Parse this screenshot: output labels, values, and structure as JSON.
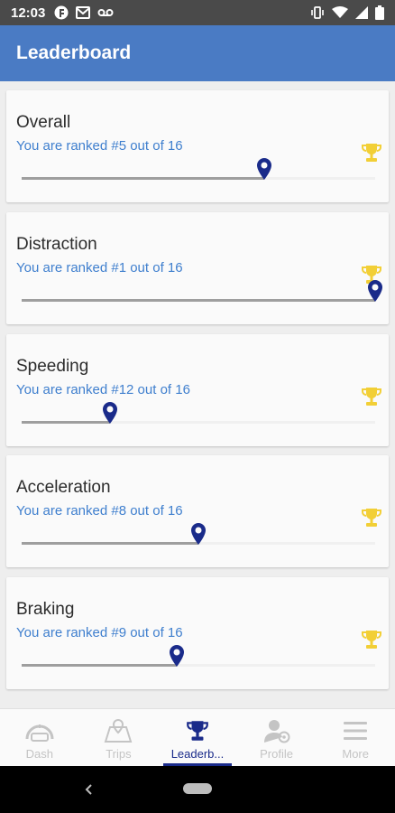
{
  "status_bar": {
    "time": "12:03"
  },
  "app_bar": {
    "title": "Leaderboard"
  },
  "colors": {
    "primary": "#4a7bc4",
    "rank_text": "#3f7fce",
    "trophy": "#f2cf36",
    "pin": "#1a2b8a",
    "active_nav": "#1a2b8a"
  },
  "cards": [
    {
      "title": "Overall",
      "rank_text": "You are ranked #5 out of 16",
      "position": 0.685
    },
    {
      "title": "Distraction",
      "rank_text": "You are ranked #1 out of 16",
      "position": 1.0
    },
    {
      "title": "Speeding",
      "rank_text": "You are ranked #12 out of 16",
      "position": 0.25
    },
    {
      "title": "Acceleration",
      "rank_text": "You are ranked #8 out of 16",
      "position": 0.5
    },
    {
      "title": "Braking",
      "rank_text": "You are ranked #9 out of 16",
      "position": 0.44
    }
  ],
  "bottom_nav": [
    {
      "label": "Dash",
      "icon": "speedometer-icon",
      "active": false
    },
    {
      "label": "Trips",
      "icon": "map-icon",
      "active": false
    },
    {
      "label": "Leaderb...",
      "icon": "trophy-icon",
      "active": true
    },
    {
      "label": "Profile",
      "icon": "profile-icon",
      "active": false
    },
    {
      "label": "More",
      "icon": "menu-icon",
      "active": false
    }
  ]
}
